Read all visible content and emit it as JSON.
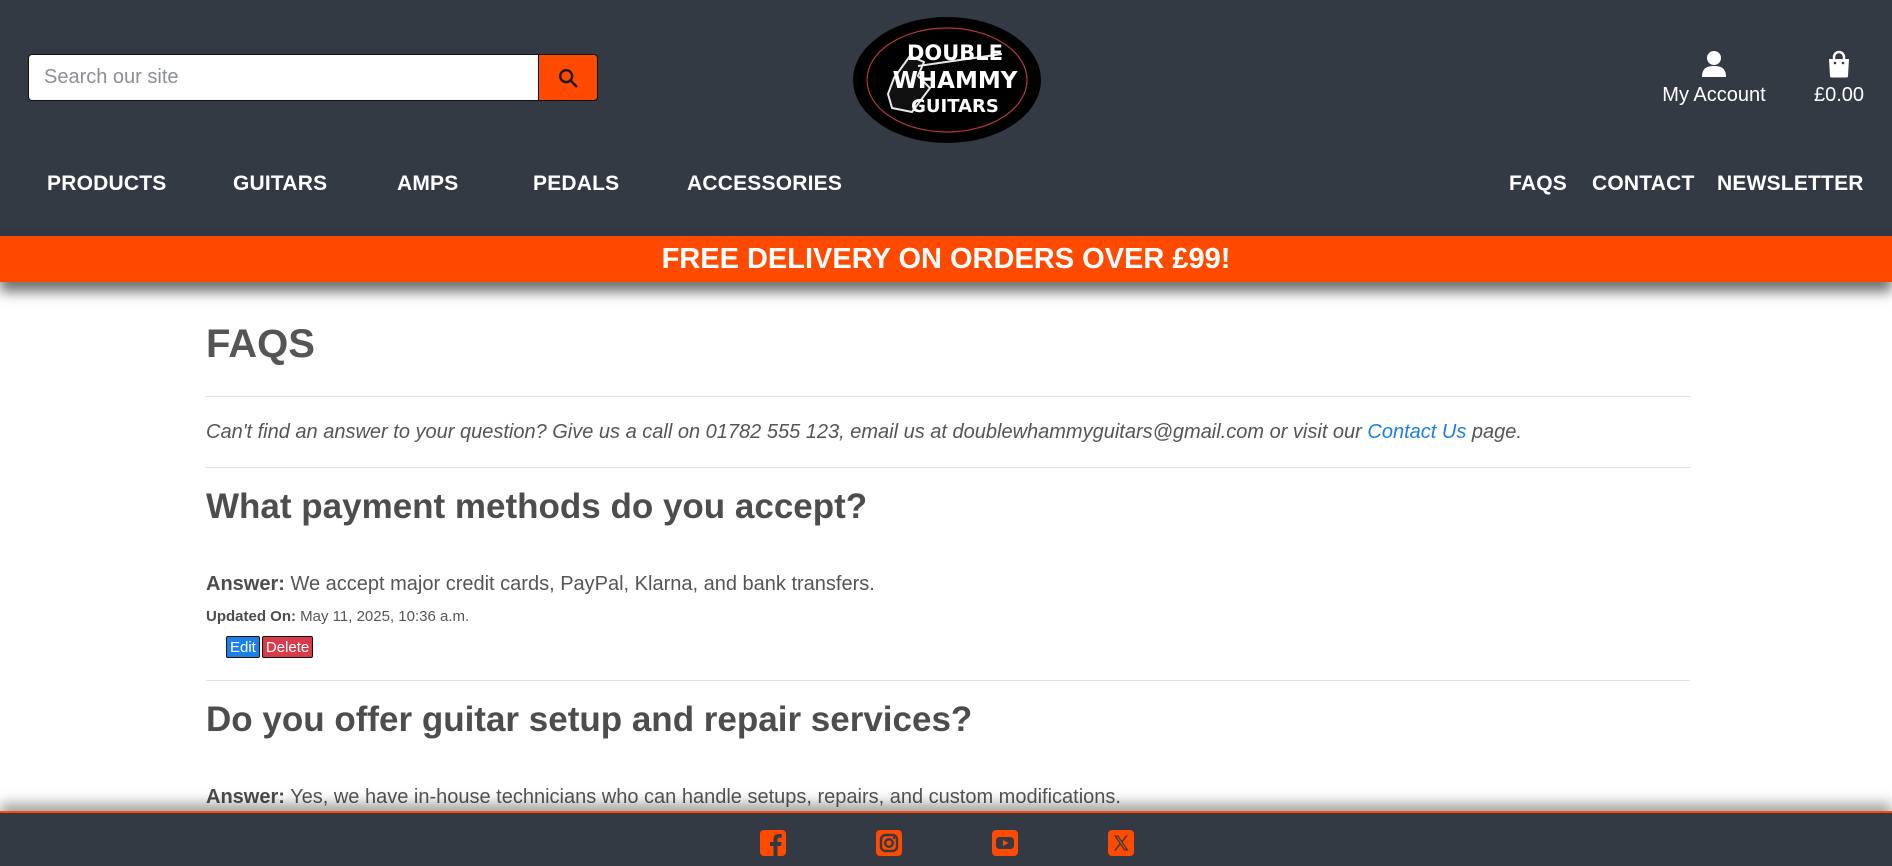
{
  "header": {
    "search": {
      "placeholder": "Search our site",
      "icon": "search-icon"
    },
    "logo": {
      "line1": "DOUBLE",
      "line2": "WHAMMY",
      "line3": "GUITARS"
    },
    "account": {
      "label": "My Account",
      "icon": "user-icon"
    },
    "cart": {
      "label": "£0.00",
      "icon": "shopping-bag-icon"
    },
    "nav_left": [
      "PRODUCTS",
      "GUITARS",
      "AMPS",
      "PEDALS",
      "ACCESSORIES"
    ],
    "nav_right": [
      "FAQS",
      "CONTACT",
      "NEWSLETTER"
    ]
  },
  "banner": {
    "text": "FREE DELIVERY ON ORDERS OVER £99!"
  },
  "page": {
    "title": "FAQS",
    "intro": {
      "before": "Can't find an answer to your question? Give us a call on 01782 555 123, email us at doublewhammyguitars@gmail.com or visit our ",
      "link": "Contact Us",
      "after": " page."
    }
  },
  "faqs": [
    {
      "question": "What payment methods do you accept?",
      "answer_label": "Answer:",
      "answer": " We accept major credit cards, PayPal, Klarna, and bank transfers.",
      "updated_label": "Updated On:",
      "updated": " May 11, 2025, 10:36 a.m.",
      "edit_label": "Edit",
      "delete_label": "Delete"
    },
    {
      "question": "Do you offer guitar setup and repair services?",
      "answer_label": "Answer:",
      "answer": " Yes, we have in-house technicians who can handle setups, repairs, and custom modifications."
    }
  ],
  "footer": {
    "social": [
      "facebook-icon",
      "instagram-icon",
      "youtube-icon",
      "x-twitter-icon"
    ]
  },
  "colors": {
    "header_bg": "#343a43",
    "accent": "#ff4a00",
    "link": "#1a7fe6",
    "delete": "#d83b4a"
  }
}
